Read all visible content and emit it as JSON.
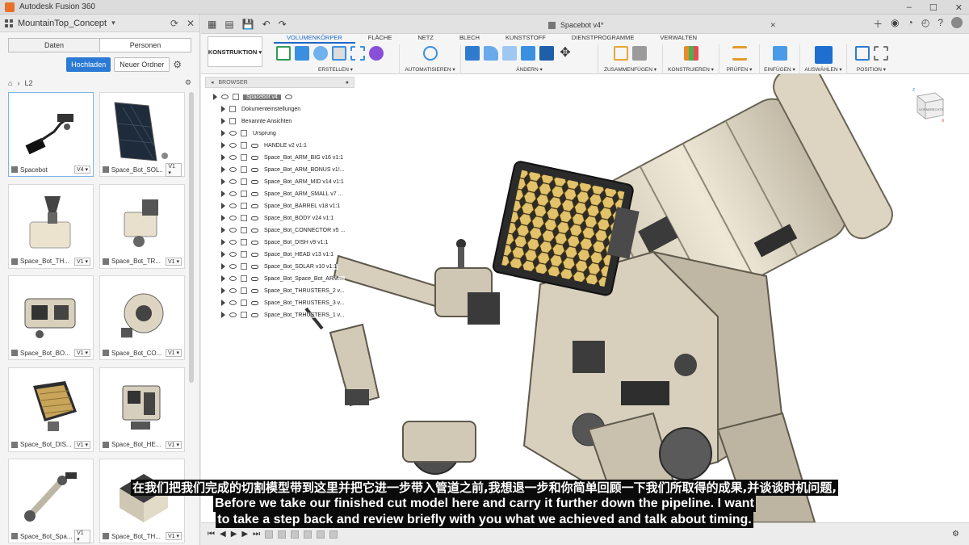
{
  "window": {
    "app_title": "Autodesk Fusion 360"
  },
  "data_panel": {
    "project_name": "MountainTop_Concept",
    "tabs": [
      "Daten",
      "Personen"
    ],
    "upload_label": "Hochladen",
    "new_folder_label": "Neuer Ordner",
    "breadcrumb": "L2",
    "files": [
      {
        "name": "Spacebot",
        "version": "V4"
      },
      {
        "name": "Space_Bot_SOL...",
        "version": "V1"
      },
      {
        "name": "Space_Bot_TH...",
        "version": "V1"
      },
      {
        "name": "Space_Bot_TR...",
        "version": "V1"
      },
      {
        "name": "Space_Bot_BO...",
        "version": "V1"
      },
      {
        "name": "Space_Bot_CO...",
        "version": "V1"
      },
      {
        "name": "Space_Bot_DIS...",
        "version": "V1"
      },
      {
        "name": "Space_Bot_HE...",
        "version": "V1"
      },
      {
        "name": "Space_Bot_Spa...",
        "version": "V1"
      },
      {
        "name": "Space_Bot_TH...",
        "version": "V1"
      }
    ]
  },
  "document": {
    "tab_title": "Spacebot v4*"
  },
  "ribbon": {
    "workspace": "KONSTRUKTION",
    "tabs": [
      "VOLUMENKÖRPER",
      "FLÄCHE",
      "NETZ",
      "BLECH",
      "KUNSTSTOFF",
      "DIENSTPROGRAMME",
      "VERWALTEN"
    ],
    "groups": [
      "ERSTELLEN",
      "AUTOMATISIEREN",
      "ÄNDERN",
      "ZUSAMMENFÜGEN",
      "KONSTRUIEREN",
      "PRÜFEN",
      "EINFÜGEN",
      "AUSWÄHLEN",
      "POSITION"
    ]
  },
  "browser": {
    "title": "BROWSER",
    "root": "Spacebot v4",
    "items": [
      "Dokumenteinstellungen",
      "Benannte Ansichten",
      "Ursprung",
      "HANDLE v2 v1:1",
      "Space_Bot_ARM_BIG v16 v1:1",
      "Space_Bot_ARM_BONUS v1!...",
      "Space_Bot_ARM_MID v14 v1:1",
      "Space_Bot_ARM_SMALL v7 ...",
      "Space_Bot_BARREL v18 v1:1",
      "Space_Bot_BODY v24 v1:1",
      "Space_Bot_CONNECTOR v5 ...",
      "Space_Bot_DISH v9 v1:1",
      "Space_Bot_HEAD v13 v1:1",
      "Space_Bot_SOLAR v10 v1:1",
      "Space_Bot_Space_Bot_ARM...",
      "Space_Bot_THRUSTERS_2 v...",
      "Space_Bot_THRUSTERS_3 v...",
      "Space_Bot_TRHUSTERS_1 v..."
    ]
  },
  "viewcube": {
    "top": "Z",
    "front": "VORNE",
    "right": "RECHTS",
    "x": "X"
  },
  "subtitles": {
    "zh": "在我们把我们完成的切割模型带到这里并把它进一步带入管道之前,我想退一步和你简单回顾一下我们所取得的成果,并谈谈时机问题,",
    "en1": "Before we take our finished cut model here and carry it further down the pipeline. I want",
    "en2": "to take a step back and review briefly with you what we achieved and talk about timing."
  }
}
